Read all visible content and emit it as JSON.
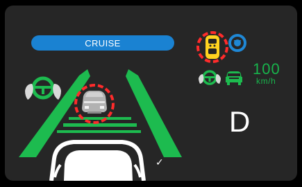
{
  "status": {
    "cruise_label": "CRUISE"
  },
  "speed": {
    "value": "100",
    "unit": "km/h"
  },
  "gear": {
    "value": "D"
  },
  "indicator": {
    "check_symbol": "✓"
  },
  "colors": {
    "screen_bg": "#262626",
    "outer_bg": "#000000",
    "cruise_blue": "#1a82d2",
    "indicator_green": "#18b44c",
    "lane_green": "#1dbb4f",
    "alert_red": "#ff2b2b",
    "warning_yellow": "#ffd21f",
    "white": "#ffffff",
    "gray": "#a8a8a8",
    "icon_blue": "#1f88d6"
  },
  "icons": {
    "steering_assist": "steering-wheel-hands-icon",
    "front_vehicle": "front-vehicle-icon",
    "vehicle_alert": "vehicle-alert-icon",
    "blue_signal": "blue-target-icon",
    "small_steering": "small-steering-icon",
    "small_car": "small-car-icon",
    "own_car": "own-car-icon"
  }
}
